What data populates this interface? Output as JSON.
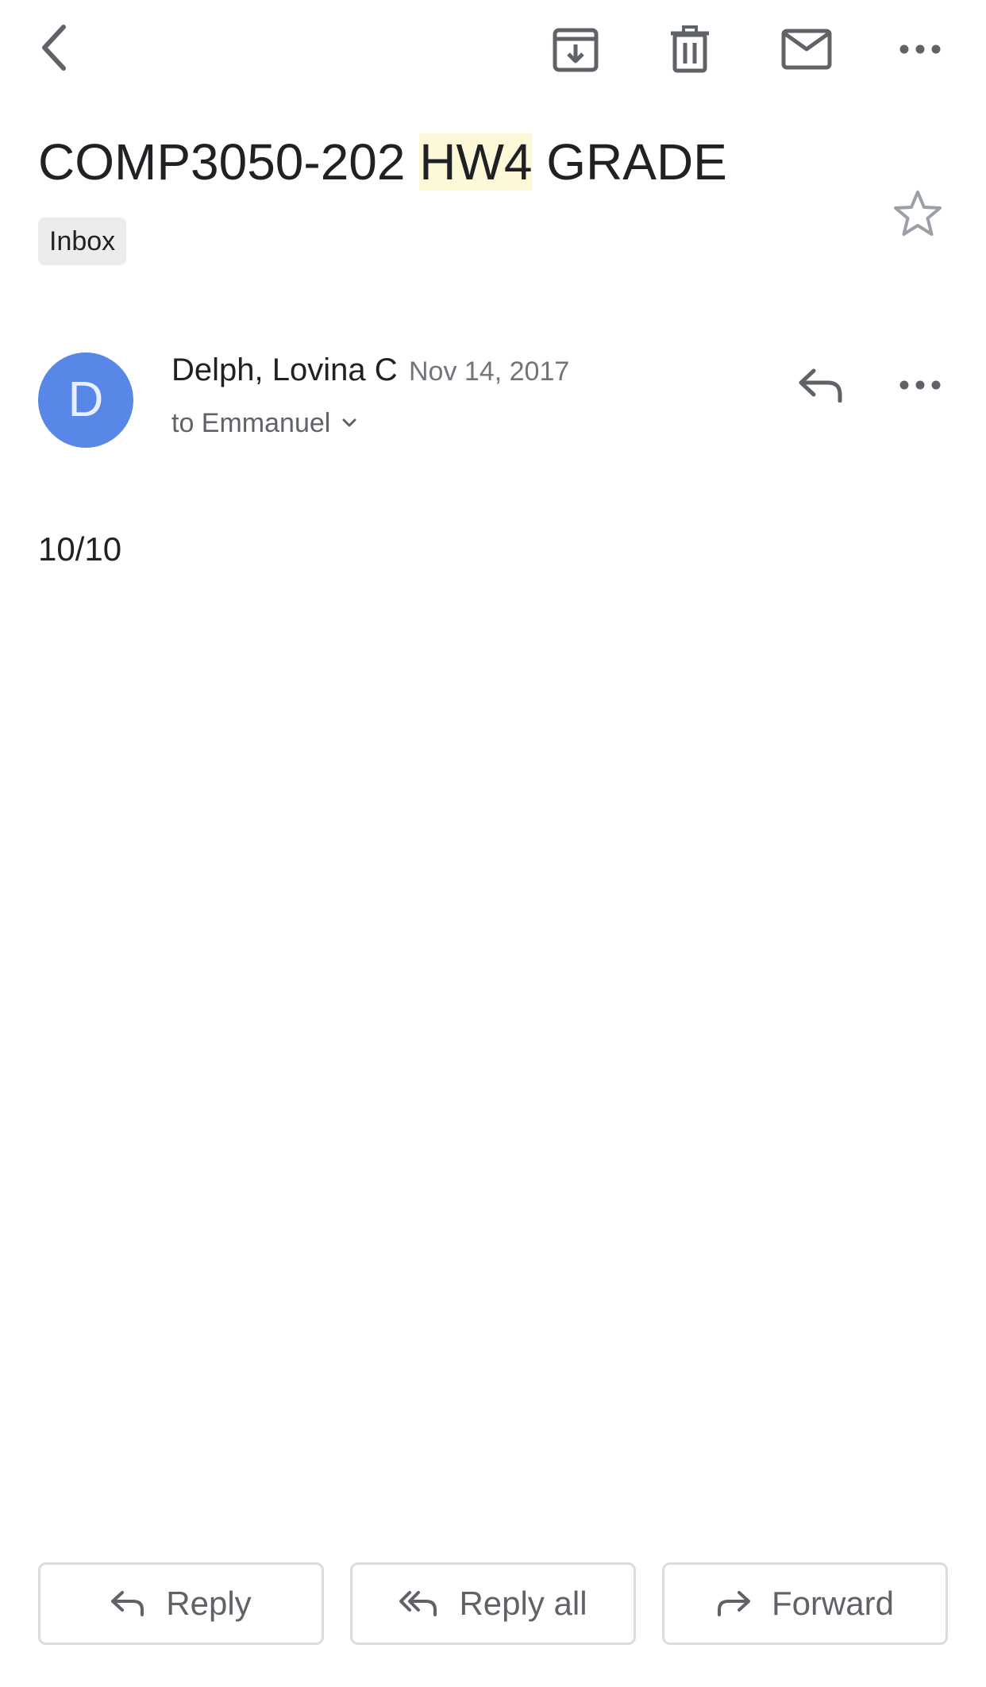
{
  "toolbar": {
    "back_icon": "arrow-back-icon",
    "archive_icon": "archive-icon",
    "delete_icon": "trash-icon",
    "mark_unread_icon": "mail-icon",
    "more_icon": "more-horizontal-icon"
  },
  "email": {
    "subject_before": "COMP3050-202 ",
    "subject_highlight": "HW4",
    "subject_after": " GRADE",
    "label": "Inbox",
    "star_icon": "star-outline-icon",
    "sender_initial": "D",
    "sender_name": "Delph, Lovina C",
    "date": "Nov 14, 2017",
    "recipient": "to Emmanuel",
    "body": "10/10",
    "avatar_color": "#5987e8",
    "highlight_color": "#fcf8d8"
  },
  "actions": {
    "reply_label": "Reply",
    "reply_all_label": "Reply all",
    "forward_label": "Forward"
  }
}
